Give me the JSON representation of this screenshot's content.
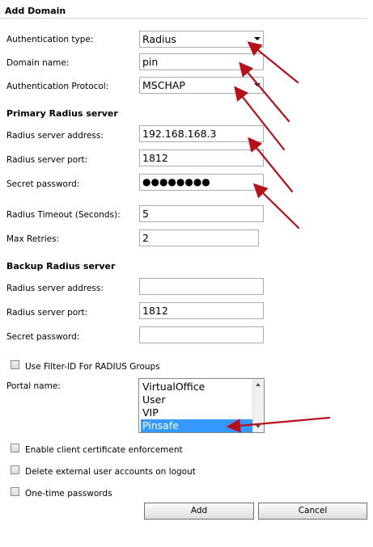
{
  "panel": {
    "title": "Add Domain"
  },
  "form": {
    "auth_type": {
      "label": "Authentication type:",
      "value": "Radius"
    },
    "domain_name": {
      "label": "Domain name:",
      "value": "pin"
    },
    "auth_protocol": {
      "label": "Authentication Protocol:",
      "value": "MSCHAP"
    }
  },
  "primary": {
    "heading": "Primary Radius server",
    "address": {
      "label": "Radius server address:",
      "value": "192.168.168.3"
    },
    "port": {
      "label": "Radius server port:",
      "value": "1812"
    },
    "secret": {
      "label": "Secret password:",
      "value": "●●●●●●●●"
    },
    "timeout": {
      "label": "Radius Timeout (Seconds):",
      "value": "5"
    },
    "retries": {
      "label": "Max Retries:",
      "value": "2"
    }
  },
  "backup": {
    "heading": "Backup Radius server",
    "address": {
      "label": "Radius server address:",
      "value": ""
    },
    "port": {
      "label": "Radius server port:",
      "value": "1812"
    },
    "secret": {
      "label": "Secret password:",
      "value": ""
    }
  },
  "filter_id": {
    "label": "Use Filter-ID For RADIUS Groups",
    "checked": false
  },
  "portal": {
    "label": "Portal name:",
    "options": [
      "VirtualOffice",
      "User",
      "VIP",
      "Pinsafe"
    ],
    "selected": "Pinsafe"
  },
  "options": {
    "client_cert": {
      "label": "Enable client certificate enforcement",
      "checked": false
    },
    "delete_accounts": {
      "label": "Delete external user accounts on logout",
      "checked": false
    },
    "otp": {
      "label": "One-time passwords",
      "checked": false
    }
  },
  "buttons": {
    "add": "Add",
    "cancel": "Cancel"
  },
  "colors": {
    "arrow": "#b8101a",
    "selection": "#3399ff"
  }
}
